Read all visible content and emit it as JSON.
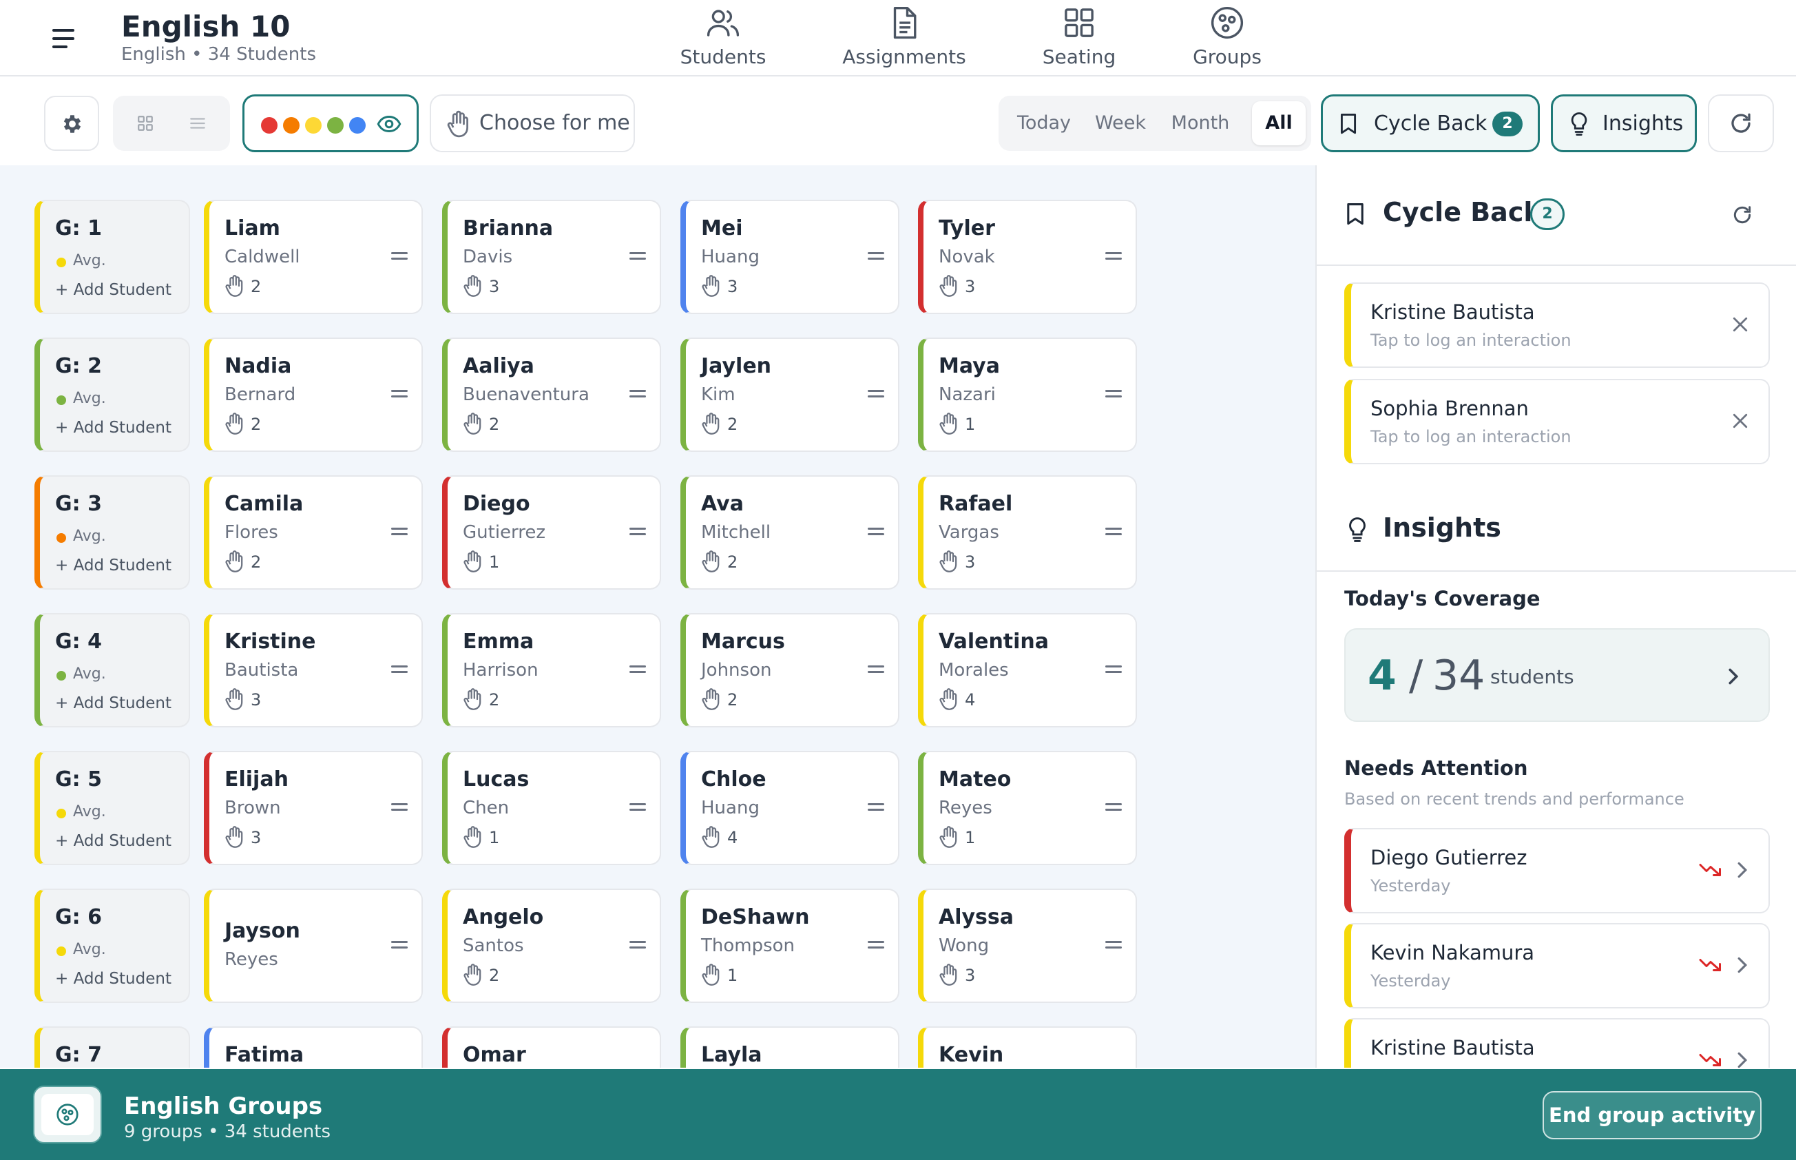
{
  "header": {
    "title": "English 10",
    "subtitle": "English • 34 Students",
    "nav": [
      {
        "label": "Students",
        "icon": "users-icon"
      },
      {
        "label": "Assignments",
        "icon": "document-icon"
      },
      {
        "label": "Seating",
        "icon": "grid-icon"
      },
      {
        "label": "Groups",
        "icon": "groups-icon"
      }
    ]
  },
  "toolbar": {
    "choose_label": "Choose for me",
    "color_dots": [
      "#e53935",
      "#f57c00",
      "#fdd835",
      "#7cb342",
      "#4285f4"
    ],
    "ranges": [
      "Today",
      "Week",
      "Month",
      "All"
    ],
    "active_range": "All",
    "cycle_back_label": "Cycle Back",
    "cycle_back_count": "2",
    "insights_label": "Insights"
  },
  "colors": {
    "teal": "#1f7a78",
    "yellow": "#f5d90a",
    "green": "#7cb342",
    "orange": "#f57c00",
    "red": "#d32f2f",
    "blue": "#4f83ee"
  },
  "groups": [
    {
      "label": "G: 1",
      "avg_label": "Avg.",
      "avg_color": "yellow",
      "add_label": "+ Add Student",
      "color": "yellow",
      "students": [
        {
          "first": "Liam",
          "last": "Caldwell",
          "count": "2",
          "color": "yellow"
        },
        {
          "first": "Brianna",
          "last": "Davis",
          "count": "3",
          "color": "green"
        },
        {
          "first": "Mei",
          "last": "Huang",
          "count": "3",
          "color": "blue"
        },
        {
          "first": "Tyler",
          "last": "Novak",
          "count": "3",
          "color": "red"
        }
      ]
    },
    {
      "label": "G: 2",
      "avg_label": "Avg.",
      "avg_color": "green",
      "add_label": "+ Add Student",
      "color": "green",
      "students": [
        {
          "first": "Nadia",
          "last": "Bernard",
          "count": "2",
          "color": "yellow"
        },
        {
          "first": "Aaliya",
          "last": "Buenaventura",
          "count": "2",
          "color": "green"
        },
        {
          "first": "Jaylen",
          "last": "Kim",
          "count": "2",
          "color": "green"
        },
        {
          "first": "Maya",
          "last": "Nazari",
          "count": "1",
          "color": "green"
        }
      ]
    },
    {
      "label": "G: 3",
      "avg_label": "Avg.",
      "avg_color": "orange",
      "add_label": "+ Add Student",
      "color": "orange",
      "students": [
        {
          "first": "Camila",
          "last": "Flores",
          "count": "2",
          "color": "yellow"
        },
        {
          "first": "Diego",
          "last": "Gutierrez",
          "count": "1",
          "color": "red"
        },
        {
          "first": "Ava",
          "last": "Mitchell",
          "count": "2",
          "color": "green"
        },
        {
          "first": "Rafael",
          "last": "Vargas",
          "count": "3",
          "color": "yellow"
        }
      ]
    },
    {
      "label": "G: 4",
      "avg_label": "Avg.",
      "avg_color": "green",
      "add_label": "+ Add Student",
      "color": "green",
      "students": [
        {
          "first": "Kristine",
          "last": "Bautista",
          "count": "3",
          "color": "yellow"
        },
        {
          "first": "Emma",
          "last": "Harrison",
          "count": "2",
          "color": "green"
        },
        {
          "first": "Marcus",
          "last": "Johnson",
          "count": "2",
          "color": "green"
        },
        {
          "first": "Valentina",
          "last": "Morales",
          "count": "4",
          "color": "yellow"
        }
      ]
    },
    {
      "label": "G: 5",
      "avg_label": "Avg.",
      "avg_color": "yellow",
      "add_label": "+ Add Student",
      "color": "yellow",
      "students": [
        {
          "first": "Elijah",
          "last": "Brown",
          "count": "3",
          "color": "red"
        },
        {
          "first": "Lucas",
          "last": "Chen",
          "count": "1",
          "color": "green"
        },
        {
          "first": "Chloe",
          "last": "Huang",
          "count": "4",
          "color": "blue"
        },
        {
          "first": "Mateo",
          "last": "Reyes",
          "count": "1",
          "color": "green"
        }
      ]
    },
    {
      "label": "G: 6",
      "avg_label": "Avg.",
      "avg_color": "yellow",
      "add_label": "+ Add Student",
      "color": "yellow",
      "students": [
        {
          "first": "Jayson",
          "last": "Reyes",
          "count": "",
          "color": "yellow"
        },
        {
          "first": "Angelo",
          "last": "Santos",
          "count": "2",
          "color": "yellow"
        },
        {
          "first": "DeShawn",
          "last": "Thompson",
          "count": "1",
          "color": "green"
        },
        {
          "first": "Alyssa",
          "last": "Wong",
          "count": "3",
          "color": "yellow"
        }
      ]
    },
    {
      "label": "G: 7",
      "avg_label": "",
      "avg_color": "yellow",
      "add_label": "",
      "color": "yellow",
      "students": [
        {
          "first": "Fatima",
          "last": "",
          "count": "",
          "color": "blue"
        },
        {
          "first": "Omar",
          "last": "",
          "count": "",
          "color": "red"
        },
        {
          "first": "Layla",
          "last": "",
          "count": "",
          "color": "green"
        },
        {
          "first": "Kevin",
          "last": "",
          "count": "",
          "color": "yellow"
        }
      ]
    }
  ],
  "panel": {
    "cycle_back": {
      "title": "Cycle Back",
      "count": "2",
      "items": [
        {
          "name": "Kristine Bautista",
          "hint": "Tap to log an interaction"
        },
        {
          "name": "Sophia Brennan",
          "hint": "Tap to log an interaction"
        }
      ]
    },
    "insights": {
      "title": "Insights",
      "coverage_label": "Today's Coverage",
      "coverage_count": "4",
      "coverage_sep": "/",
      "coverage_total": "34",
      "coverage_unit": "students",
      "needs_label": "Needs Attention",
      "needs_sub": "Based on recent trends and performance",
      "needs": [
        {
          "name": "Diego Gutierrez",
          "when": "Yesterday",
          "color": "red"
        },
        {
          "name": "Kevin Nakamura",
          "when": "Yesterday",
          "color": "yellow"
        },
        {
          "name": "Kristine Bautista",
          "when": "",
          "color": "yellow"
        }
      ]
    }
  },
  "footer": {
    "title": "English Groups",
    "subtitle": "9 groups • 34 students",
    "end_label": "End group activity"
  }
}
